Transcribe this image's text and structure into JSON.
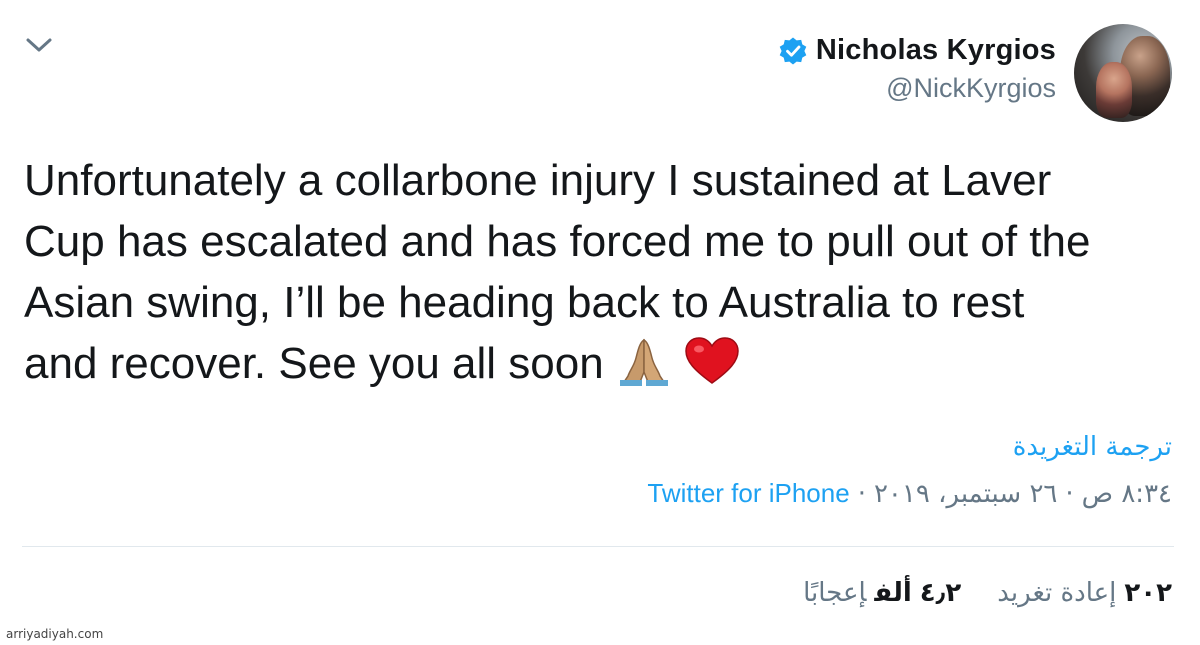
{
  "header": {
    "display_name": "Nicholas Kyrgios",
    "handle": "@NickKyrgios",
    "verified": true,
    "verified_color": "#1da1f2",
    "avatar_icon": "profile-photo"
  },
  "tweet": {
    "text": "Unfortunately a collarbone injury I sustained at Laver\nCup has escalated and has forced me to pull out of the\nAsian swing, I’ll be heading back to Australia to rest\nand recover. See you all soon",
    "emojis": [
      "folded-hands",
      "red-heart"
    ]
  },
  "translate_label": "ترجمة التغريدة",
  "meta": {
    "time": "٨:٣٤ ص",
    "date": "٢٦ سبتمبر، ٢٠١٩",
    "separator": "·",
    "source": "Twitter for iPhone"
  },
  "stats": {
    "retweets_count": "٢٠٢",
    "retweets_label": "إعادة تغريد",
    "likes_count": "٤٫٢",
    "likes_unit": "ألف",
    "likes_label": "إعجابًا"
  },
  "watermark": "arriyadiyah.com",
  "colors": {
    "accent": "#1da1f2",
    "text": "#14171a",
    "muted": "#657786",
    "divider": "#e1e8ed"
  }
}
